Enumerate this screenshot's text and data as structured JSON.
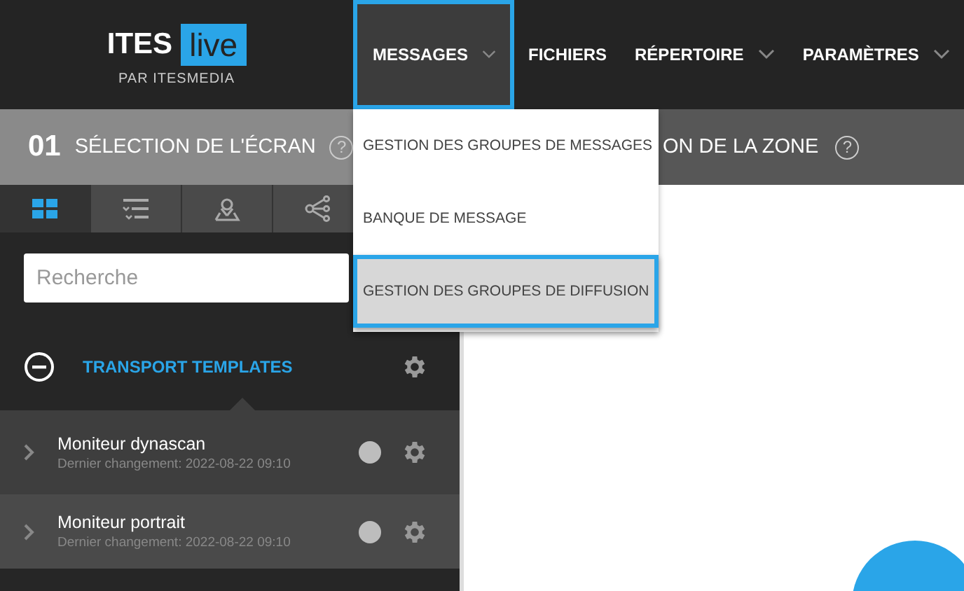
{
  "logo": {
    "brand": "ITES",
    "badge": "live",
    "tagline": "PAR ITESMEDIA"
  },
  "nav": [
    {
      "label": "MESSAGES",
      "selected": true,
      "dropdown": true
    },
    {
      "label": "FICHIERS",
      "selected": false,
      "dropdown": false
    },
    {
      "label": "RÉPERTOIRE",
      "selected": false,
      "dropdown": true
    },
    {
      "label": "PARAMÈTRES",
      "selected": false,
      "dropdown": true
    }
  ],
  "menu": [
    {
      "label": "GESTION DES GROUPES DE MESSAGES",
      "selected": false
    },
    {
      "label": "BANQUE DE MESSAGE",
      "selected": false
    },
    {
      "label": "GESTION DES GROUPES DE DIFFUSION",
      "selected": true
    }
  ],
  "step1": {
    "number": "01",
    "title": "SÉLECTION DE L'ÉCRAN",
    "help": "?"
  },
  "step2": {
    "title": "ON DE LA ZONE",
    "help": "?"
  },
  "view_tabs": [
    {
      "kind": "grid",
      "selected": true
    },
    {
      "kind": "list",
      "selected": false
    },
    {
      "kind": "pin",
      "selected": false
    },
    {
      "kind": "share",
      "selected": false
    }
  ],
  "search": {
    "placeholder": "Recherche"
  },
  "group": {
    "name": "TRANSPORT TEMPLATES",
    "expanded": true
  },
  "screens": [
    {
      "name": "Moniteur dynascan",
      "changed": "Dernier changement: 2022-08-22 09:10",
      "color": "#bdbdbd"
    },
    {
      "name": "Moniteur portrait",
      "changed": "Dernier changement: 2022-08-22 09:10",
      "color": "#bdbdbd"
    }
  ]
}
